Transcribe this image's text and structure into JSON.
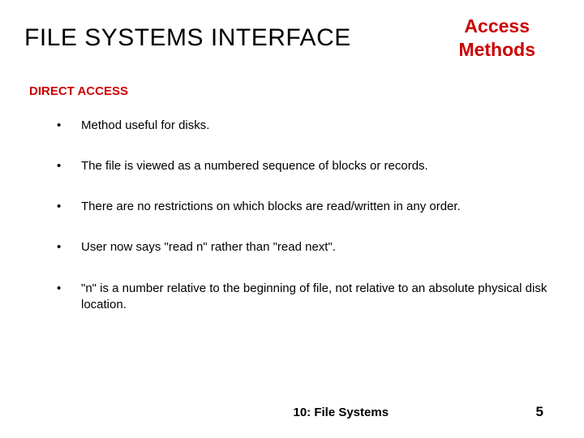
{
  "header": {
    "title": "FILE SYSTEMS INTERFACE",
    "subtitle_line1": "Access",
    "subtitle_line2": "Methods"
  },
  "section": {
    "heading": "DIRECT ACCESS"
  },
  "bullets": [
    "Method useful for disks.",
    "The file is viewed as a numbered sequence of blocks or records.",
    "There are no restrictions on which blocks are read/written in any order.",
    "User now says \"read n\" rather than \"read next\".",
    "\"n\" is a number relative to the beginning of file, not relative to an absolute physical disk location."
  ],
  "footer": {
    "title": "10: File Systems",
    "page": "5"
  }
}
